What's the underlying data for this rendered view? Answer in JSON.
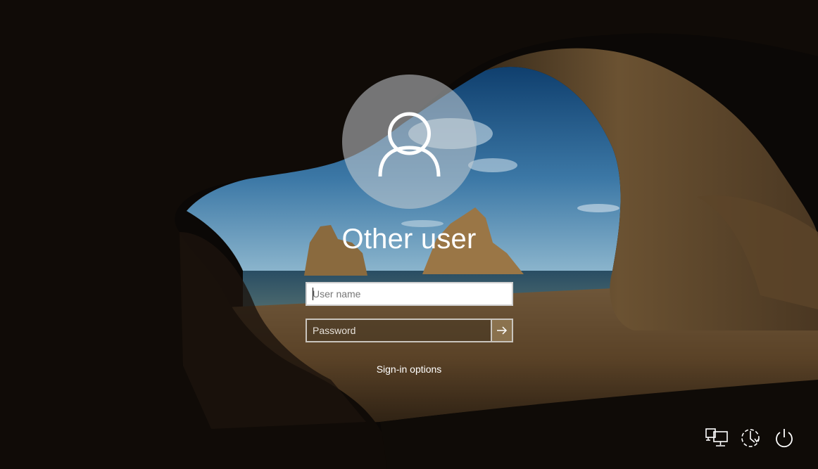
{
  "login": {
    "display_name": "Other user",
    "username_placeholder": "User name",
    "username_value": "",
    "password_placeholder": "Password",
    "password_value": "",
    "signin_options": "Sign-in options"
  },
  "icons": {
    "avatar": "user-silhouette-icon",
    "submit": "arrow-right-icon",
    "network": "network-icon",
    "ease_of_access": "ease-of-access-icon",
    "power": "power-icon"
  },
  "colors": {
    "text": "#ffffff",
    "avatar_fill": "#c8cdd2",
    "input_border": "#c9c4bd"
  }
}
